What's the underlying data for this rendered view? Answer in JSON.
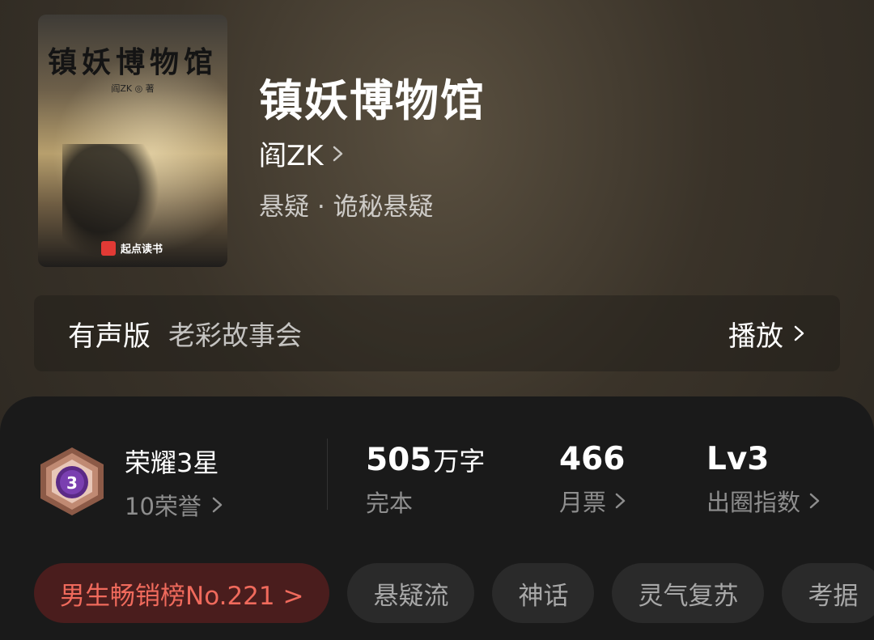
{
  "book": {
    "cover_title": "镇妖博物馆",
    "cover_author": "阎ZK ◎ 著",
    "cover_brand": "起点读书",
    "title": "镇妖博物馆",
    "author": "阎ZK",
    "genre": "悬疑 · 诡秘悬疑"
  },
  "audio": {
    "label": "有声版",
    "narrator": "老彩故事会",
    "play_label": "播放"
  },
  "honor": {
    "title": "荣耀3星",
    "points": "10荣誉",
    "badge_number": "3"
  },
  "stats": {
    "words_value": "505",
    "words_unit": "万字",
    "words_label": "完本",
    "tickets_value": "466",
    "tickets_label": "月票",
    "level_value": "Lv3",
    "level_label": "出圈指数"
  },
  "tags": {
    "rank": "男生畅销榜No.221 >",
    "items": [
      "悬疑流",
      "神话",
      "灵气复苏",
      "考据"
    ]
  },
  "colors": {
    "accent_red": "#f06a5c",
    "rank_bg": "#4a1d1d",
    "sheet_bg": "#1a1a1a"
  }
}
